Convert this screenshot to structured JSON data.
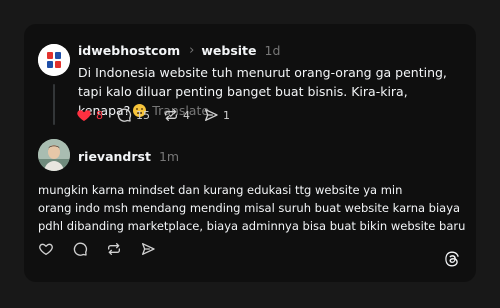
{
  "post": {
    "username": "idwebhostcom",
    "separator": "›",
    "topic": "website",
    "time": "1d",
    "text": "Di Indonesia website tuh menurut orang-orang ga penting, tapi kalo diluar penting banget buat bisnis. Kira-kira, kenapa?",
    "translate_label": "Translate",
    "emoji_icon": "thinking-face-emoji",
    "actions": {
      "likes": "8",
      "replies": "15",
      "reposts": "4",
      "shares": "1"
    },
    "like_color": "#ff3040"
  },
  "reply": {
    "username": "rievandrst",
    "time": "1m",
    "lines": [
      "mungkin karna mindset dan kurang edukasi ttg website ya min",
      "orang indo msh mendang mending misal suruh buat website karna biaya",
      "pdhl dibanding marketplace, biaya adminnya bisa buat bikin website baru"
    ]
  },
  "colors": {
    "background": "#181818",
    "card": "#0f0f0f",
    "text": "#f3f5f7",
    "muted": "#777777"
  }
}
